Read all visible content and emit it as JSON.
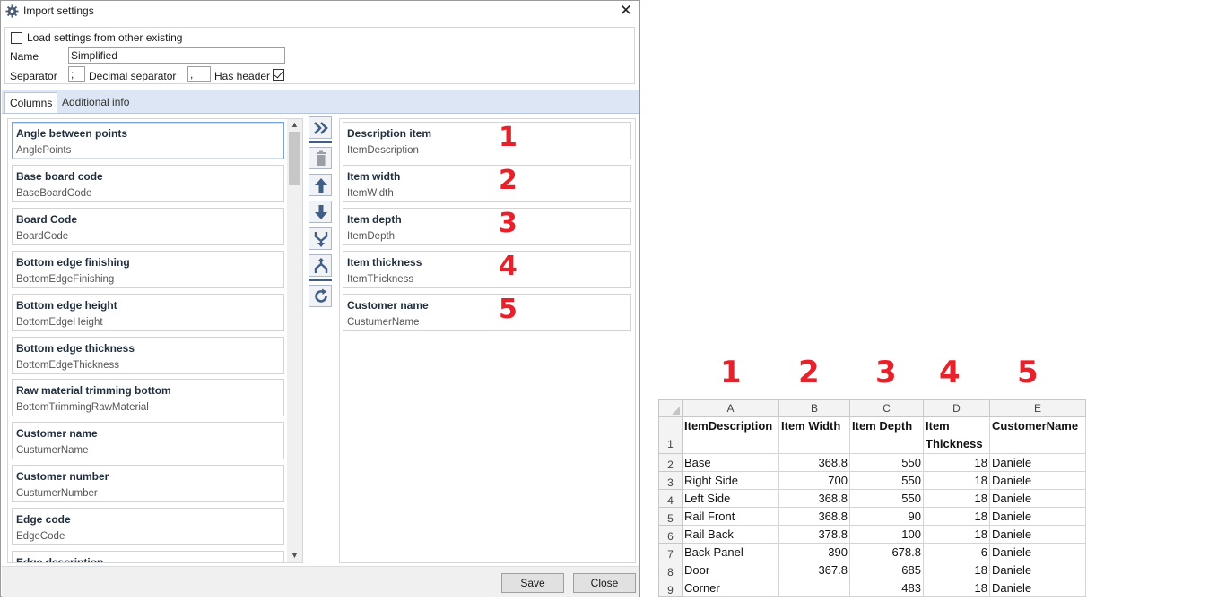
{
  "dialog": {
    "title": "Import settings",
    "close_glyph": "✕",
    "load_settings_label": "Load settings from other existing",
    "load_settings_checked": false,
    "name_label": "Name",
    "name_value": "Simplified",
    "separator_label": "Separator",
    "separator_value": ";",
    "decimal_separator_label": "Decimal separator",
    "decimal_separator_value": ",",
    "has_header_label": "Has header",
    "has_header_checked": true
  },
  "tabs": [
    {
      "label": "Columns",
      "active": true
    },
    {
      "label": "Additional info",
      "active": false
    }
  ],
  "available_columns": [
    {
      "title": "Angle between points",
      "field": "AnglePoints"
    },
    {
      "title": "Base board code",
      "field": "BaseBoardCode"
    },
    {
      "title": "Board Code",
      "field": "BoardCode"
    },
    {
      "title": "Bottom edge finishing",
      "field": "BottomEdgeFinishing"
    },
    {
      "title": "Bottom edge height",
      "field": "BottomEdgeHeight"
    },
    {
      "title": "Bottom edge thickness",
      "field": "BottomEdgeThickness"
    },
    {
      "title": "Raw material trimming bottom",
      "field": "BottomTrimmingRawMaterial"
    },
    {
      "title": "Customer name",
      "field": "CustumerName"
    },
    {
      "title": "Customer number",
      "field": "CustumerNumber"
    },
    {
      "title": "Edge code",
      "field": "EdgeCode"
    },
    {
      "title": "Edge description",
      "field": ""
    }
  ],
  "toolbar_icons": [
    "add-all-icon",
    "delete-icon",
    "move-up-icon",
    "move-down-icon",
    "merge-icon",
    "split-icon",
    "refresh-icon"
  ],
  "selected_columns": [
    {
      "title": "Description item",
      "field": "ItemDescription",
      "marker": "1"
    },
    {
      "title": "Item width",
      "field": "ItemWidth",
      "marker": "2"
    },
    {
      "title": "Item depth",
      "field": "ItemDepth",
      "marker": "3"
    },
    {
      "title": "Item thickness",
      "field": "ItemThickness",
      "marker": "4"
    },
    {
      "title": "Customer name",
      "field": "CustumerName",
      "marker": "5"
    }
  ],
  "footer": {
    "save_label": "Save",
    "close_label": "Close"
  },
  "spreadsheet": {
    "column_markers": [
      "1",
      "2",
      "3",
      "4",
      "5"
    ],
    "column_letters": [
      "A",
      "B",
      "C",
      "D",
      "E"
    ],
    "header_row": [
      "ItemDescription",
      "Item Width",
      "Item Depth",
      "Item Thickness",
      "CustomerName"
    ],
    "rows": [
      {
        "n": "1",
        "cells": [
          "ItemDescription",
          "Item Width",
          "Item Depth",
          "Item Thickness",
          "CustomerName"
        ]
      },
      {
        "n": "2",
        "cells": [
          "Base",
          "368.8",
          "550",
          "18",
          "Daniele"
        ]
      },
      {
        "n": "3",
        "cells": [
          "Right Side",
          "700",
          "550",
          "18",
          "Daniele"
        ]
      },
      {
        "n": "4",
        "cells": [
          "Left Side",
          "368.8",
          "550",
          "18",
          "Daniele"
        ]
      },
      {
        "n": "5",
        "cells": [
          "Rail Front",
          "368.8",
          "90",
          "18",
          "Daniele"
        ]
      },
      {
        "n": "6",
        "cells": [
          "Rail Back",
          "378.8",
          "100",
          "18",
          "Daniele"
        ]
      },
      {
        "n": "7",
        "cells": [
          "Back Panel",
          "390",
          "678.8",
          "6",
          "Daniele"
        ]
      },
      {
        "n": "8",
        "cells": [
          "Door",
          "367.8",
          "685",
          "18",
          "Daniele"
        ]
      },
      {
        "n": "9",
        "cells": [
          "Corner",
          "",
          "483",
          "18",
          "Daniele"
        ]
      }
    ]
  },
  "colors": {
    "accent": "#3f5f86",
    "marker": "#e8202a",
    "tabstrip": "#dce6f4"
  }
}
